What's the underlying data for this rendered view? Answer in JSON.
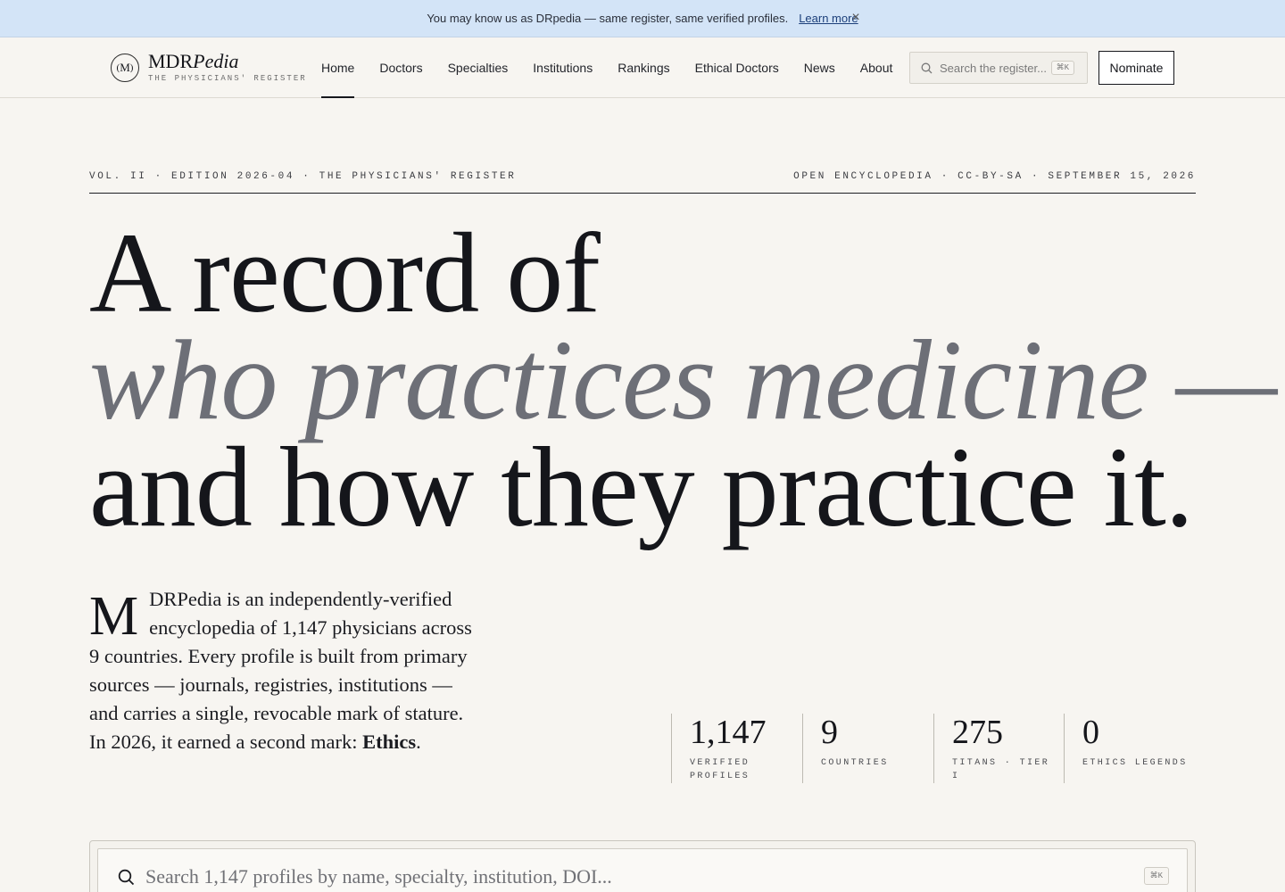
{
  "announcement": {
    "message": "You may know us as DRpedia — same register, same verified profiles.",
    "link_label": "Learn more",
    "close_glyph": "×"
  },
  "brand": {
    "monogram": "M",
    "name_plain": "MDR",
    "name_italic": "Pedia",
    "tagline": "THE PHYSICIANS' REGISTER"
  },
  "nav": {
    "items": [
      {
        "label": "Home",
        "active": true
      },
      {
        "label": "Doctors"
      },
      {
        "label": "Specialties"
      },
      {
        "label": "Institutions"
      },
      {
        "label": "Rankings"
      },
      {
        "label": "Ethical Doctors"
      },
      {
        "label": "News"
      },
      {
        "label": "About"
      }
    ]
  },
  "header_search": {
    "placeholder": "Search the register...",
    "shortcut": "⌘K",
    "icon": "search-icon"
  },
  "nominate_label": "Nominate",
  "meta": {
    "left": "VOL. II · EDITION 2026-04 · THE PHYSICIANS' REGISTER",
    "right": "OPEN ENCYCLOPEDIA · CC-BY-SA · SEPTEMBER 15, 2026"
  },
  "headline": {
    "line1": "A record of",
    "line2": "who practices medicine —",
    "line3": "and how they practice it."
  },
  "intro": {
    "dropcap": "M",
    "text": "DRPedia is an independently-verified encyclopedia of 1,147 physicians across 9 countries. Every profile is built from primary sources — journals, registries, institutions — and carries a single, revocable mark of stature. In 2026, it earned a second mark: ",
    "emphasis": "Ethics",
    "end": "."
  },
  "stats": [
    {
      "value": "1,147",
      "label": "VERIFIED PROFILES"
    },
    {
      "value": "9",
      "label": "COUNTRIES"
    },
    {
      "value": "275",
      "label": "TITANS · TIER I"
    },
    {
      "value": "0",
      "label": "ETHICS LEGENDS"
    }
  ],
  "big_search": {
    "placeholder": "Search 1,147 profiles by name, specialty, institution, DOI...",
    "shortcut": "⌘K",
    "icon": "search-icon"
  },
  "colors": {
    "background": "#f7f5f1",
    "announcement_bg": "#d3e4f7",
    "text": "#16171c",
    "italic_accent": "#6d6f77"
  }
}
